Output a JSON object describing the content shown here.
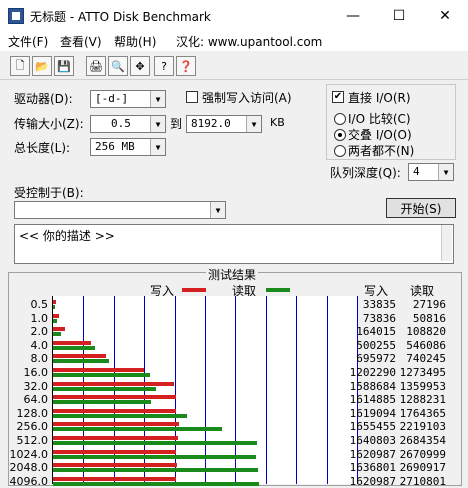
{
  "window": {
    "title": "无标题 - ATTO Disk Benchmark",
    "min": "—",
    "max": "☐",
    "close": "✕"
  },
  "menu": [
    "文件(F)",
    "查看(V)",
    "帮助(H)",
    "汉化: www.upantool.com"
  ],
  "toolbar": [
    "🗋",
    "📂",
    "💾",
    "🖨",
    "🔍",
    "✥",
    "?",
    "❓"
  ],
  "form": {
    "drive_label": "驱动器(D):",
    "drive_value": "[-d-]",
    "force_write_label": "强制写入访问(A)",
    "transfer_label": "传输大小(Z):",
    "transfer_from": "0.5",
    "to_label": "到",
    "transfer_to": "8192.0",
    "kb_label": "KB",
    "total_label": "总长度(L):",
    "total_value": "256 MB",
    "direct_io_label": "直接 I/O(R)",
    "direct_io_checked": "✔",
    "io_compare": "I/O 比较(C)",
    "overlap_io": "交叠 I/O(O)",
    "neither": "两者都不(N)",
    "queue_label": "队列深度(Q):",
    "queue_value": "4",
    "controlled_label": "受控制于(B):",
    "controlled_value": "",
    "start_button": "开始(S)",
    "description": "<< 你的描述 >>"
  },
  "results_title": "测试结果",
  "legend": {
    "write": "写入",
    "read": "读取"
  },
  "columns": {
    "write": "写入",
    "read": "读取"
  },
  "colors": {
    "write": "#d42020",
    "read": "#1a8a1a",
    "grid": "#0000c0"
  },
  "chart_data": {
    "type": "bar",
    "categories": [
      "0.5",
      "1.0",
      "2.0",
      "4.0",
      "8.0",
      "16.0",
      "32.0",
      "64.0",
      "128.0",
      "256.0",
      "512.0",
      "1024.0",
      "2048.0",
      "4096.0"
    ],
    "series": [
      {
        "name": "写入",
        "values": [
          33835,
          73836,
          164015,
          500255,
          695972,
          1202290,
          1588684,
          1614885,
          1619094,
          1655455,
          1640803,
          1620987,
          1636801,
          1620987
        ]
      },
      {
        "name": "读取",
        "values": [
          27196,
          50816,
          108820,
          546086,
          740245,
          1273495,
          1359953,
          1288231,
          1764365,
          2219103,
          2684354,
          2670999,
          2690917,
          2710801
        ]
      }
    ],
    "xlim": [
      0,
      4000000
    ]
  }
}
